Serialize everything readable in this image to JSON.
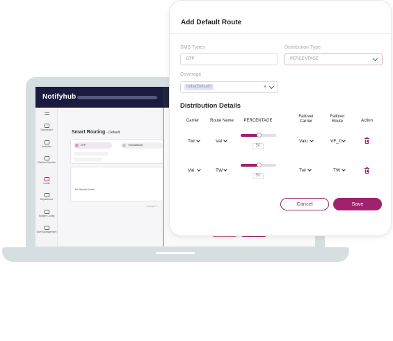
{
  "background_app": {
    "brand": "Notifyhub",
    "sidebar": [
      {
        "label": "Dashboard"
      },
      {
        "label": "Analytics"
      },
      {
        "label": "Platform Monitor"
      },
      {
        "label": "Limits"
      },
      {
        "label": "Department"
      },
      {
        "label": "System Config"
      },
      {
        "label": "User Management"
      }
    ],
    "page_title": "Smart Routing",
    "page_subtitle": "- Default",
    "tabs": [
      "OTP",
      "Transactional"
    ],
    "empty_message": "No Record Found",
    "footer": "Copyright ©"
  },
  "modal": {
    "title": "Add Default Route",
    "fields": {
      "sms_types": {
        "label": "SMS Types",
        "value": "OTP"
      },
      "distribution_type": {
        "label": "Distribution Type",
        "value": "PERCENTAGE"
      },
      "coverage": {
        "label": "Coverage",
        "chip": "India(Default)",
        "clear": "×"
      }
    },
    "section_title": "Distribution Details",
    "columns": [
      "Carrier",
      "Route Name",
      "PERCENTAGE",
      "Fallover Carrier",
      "Fallover Route",
      "Action"
    ],
    "rows": [
      {
        "carrier": "Twl",
        "route_name": "Val",
        "percentage": 50,
        "fallover_carrier": "Valu",
        "fallover_route": "VF_C"
      },
      {
        "carrier": "Val",
        "route_name": "TW",
        "percentage": 50,
        "fallover_carrier": "Twl",
        "fallover_route": "TW"
      }
    ],
    "cancel_label": "Cancel",
    "save_label": "Save"
  },
  "colors": {
    "accent": "#a0226e",
    "topbar": "#1a1b3f",
    "laptop": "#d5dee1"
  },
  "icons": [
    "trash-icon",
    "chevron-down-icon",
    "close-icon"
  ]
}
